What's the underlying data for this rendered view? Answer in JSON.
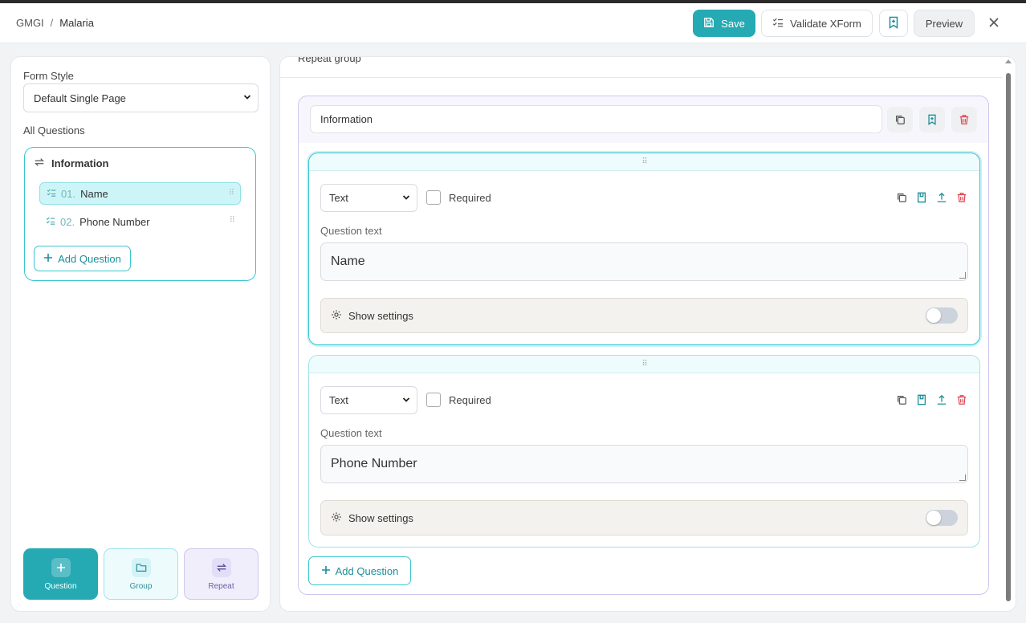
{
  "breadcrumb": {
    "root": "GMGI",
    "separator": "/",
    "current": "Malaria"
  },
  "toolbar": {
    "save_label": "Save",
    "validate_label": "Validate XForm",
    "preview_label": "Preview"
  },
  "sidebar": {
    "form_style_label": "Form Style",
    "form_style_value": "Default Single Page",
    "all_questions_label": "All Questions",
    "group_name": "Information",
    "items": [
      {
        "num": "01.",
        "label": "Name",
        "active": true
      },
      {
        "num": "02.",
        "label": "Phone Number",
        "active": false
      }
    ],
    "add_question_label": "Add Question",
    "tools": {
      "question": "Question",
      "group": "Group",
      "repeat": "Repeat"
    }
  },
  "main": {
    "section_title": "Repeat group",
    "group_name": "Information",
    "questions": [
      {
        "type": "Text",
        "required_label": "Required",
        "question_text_label": "Question text",
        "question_text": "Name",
        "settings_label": "Show settings"
      },
      {
        "type": "Text",
        "required_label": "Required",
        "question_text_label": "Question text",
        "question_text": "Phone Number",
        "settings_label": "Show settings"
      }
    ],
    "add_question_label": "Add Question"
  },
  "colors": {
    "accent": "#25a9b3",
    "accent_border": "#39c6d0",
    "danger": "#e0434f",
    "repeat_purple": "#cfc6ee"
  }
}
